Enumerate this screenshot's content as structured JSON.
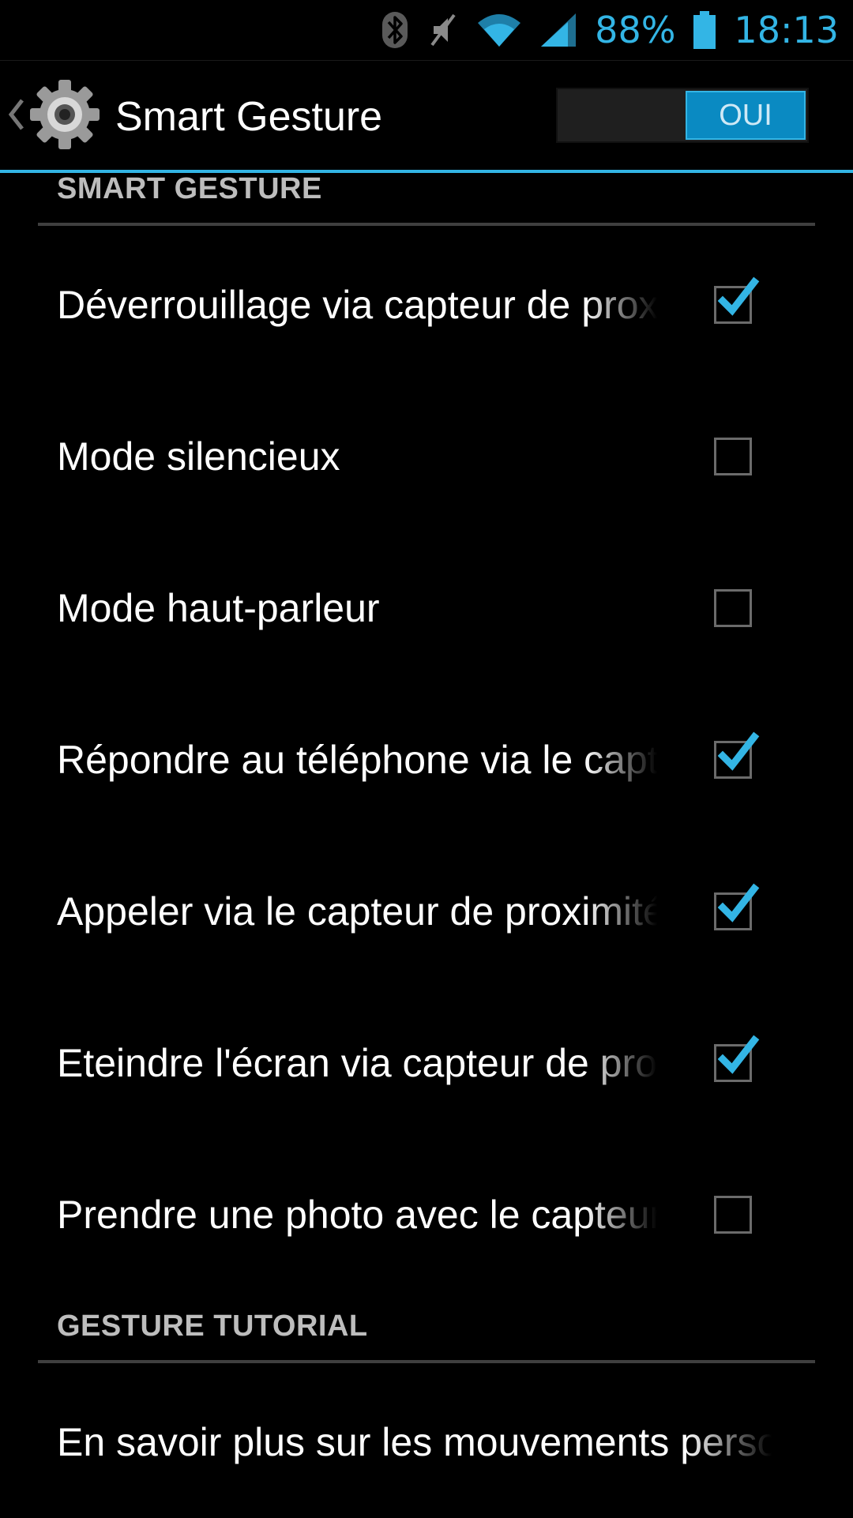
{
  "status_bar": {
    "battery": "88%",
    "time": "18:13",
    "icons": [
      "bluetooth-icon",
      "mute-icon",
      "wifi-icon",
      "signal-icon",
      "battery-icon"
    ]
  },
  "action_bar": {
    "title": "Smart Gesture",
    "icon": "gear-icon",
    "switch_label": "OUI",
    "switch_on": true
  },
  "sections": [
    {
      "header": "SMART GESTURE",
      "items": [
        {
          "title": "Déverrouillage via capteur de proximité",
          "checked": true
        },
        {
          "title": "Mode silencieux",
          "checked": false
        },
        {
          "title": "Mode haut-parleur",
          "checked": false
        },
        {
          "title": "Répondre au téléphone via le capteur",
          "checked": true
        },
        {
          "title": "Appeler via le capteur de proximité",
          "checked": true
        },
        {
          "title": "Eteindre l'écran via capteur de proximité",
          "checked": true
        },
        {
          "title": "Prendre une photo avec le capteur",
          "checked": false
        }
      ]
    },
    {
      "header": "GESTURE TUTORIAL",
      "items": [
        {
          "title": "En savoir plus sur les mouvements personnalisés"
        }
      ]
    }
  ],
  "colors": {
    "accent": "#33b5e5",
    "switch_on": "#0a8ac2",
    "background": "#000000"
  }
}
